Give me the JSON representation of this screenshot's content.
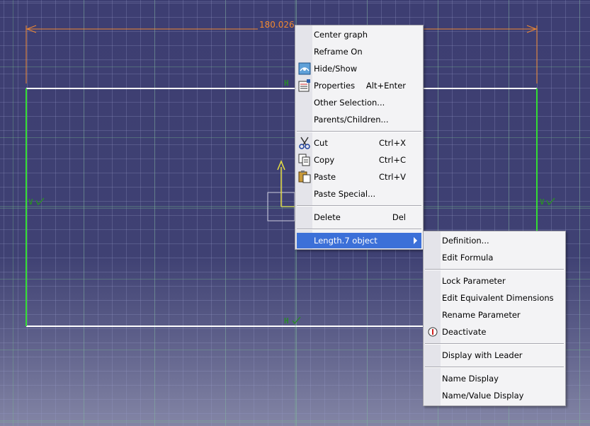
{
  "dimension": {
    "value": "180.026"
  },
  "constraints": {
    "h_top": "H",
    "h_bottom": "H",
    "v_left": "V",
    "v_right": "V"
  },
  "context_menu": {
    "items": [
      {
        "label": "Center graph",
        "shortcut": "",
        "icon": ""
      },
      {
        "label": "Reframe On",
        "shortcut": "",
        "icon": ""
      },
      {
        "label": "Hide/Show",
        "shortcut": "",
        "icon": "hide-show-icon"
      },
      {
        "label": "Properties",
        "shortcut": "Alt+Enter",
        "icon": "properties-icon"
      },
      {
        "label": "Other Selection...",
        "shortcut": "",
        "icon": ""
      },
      {
        "label": "Parents/Children...",
        "shortcut": "",
        "icon": ""
      },
      {
        "label": "Cut",
        "shortcut": "Ctrl+X",
        "icon": "scissors-icon"
      },
      {
        "label": "Copy",
        "shortcut": "Ctrl+C",
        "icon": "copy-icon"
      },
      {
        "label": "Paste",
        "shortcut": "Ctrl+V",
        "icon": "paste-icon"
      },
      {
        "label": "Paste Special...",
        "shortcut": "",
        "icon": ""
      },
      {
        "label": "Delete",
        "shortcut": "Del",
        "icon": ""
      },
      {
        "label": "Length.7 object",
        "shortcut": "",
        "icon": "",
        "submenu": true,
        "selected": true
      }
    ]
  },
  "submenu": {
    "items": [
      {
        "label": "Definition...",
        "icon": ""
      },
      {
        "label": "Edit Formula",
        "icon": ""
      },
      {
        "label": "Lock Parameter",
        "icon": ""
      },
      {
        "label": "Edit Equivalent Dimensions",
        "icon": ""
      },
      {
        "label": "Rename Parameter",
        "icon": ""
      },
      {
        "label": "Deactivate",
        "icon": "deactivate-icon"
      },
      {
        "label": "Display with Leader",
        "icon": ""
      },
      {
        "label": "Name Display",
        "icon": ""
      },
      {
        "label": "Name/Value Display",
        "icon": ""
      }
    ]
  },
  "colors": {
    "background": "#3d3e72",
    "dimension": "#f08830",
    "constraint_line": "#33dd33",
    "sketch_line": "#ffffff",
    "highlight": "#3c70d8"
  }
}
